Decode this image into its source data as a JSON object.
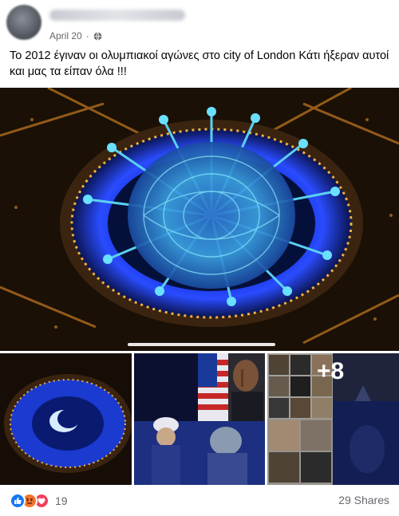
{
  "post": {
    "date": "April 20",
    "dot": "·",
    "text": "Το 2012 έγιναν οι ολυμπιακοί αγώνες στο city of London Κάτι ήξεραν αυτοί και μας τα είπαν όλα !!!",
    "privacy_icon": "globe-icon"
  },
  "media": {
    "more_count": "+8"
  },
  "footer": {
    "reaction_icons": [
      "like-icon",
      "angry-icon",
      "love-icon"
    ],
    "reaction_count": "19",
    "shares": "29 Shares"
  },
  "colors": {
    "text": "#050505",
    "secondary": "#65676b",
    "like": "#1877f2",
    "angry": "#f3742a",
    "love": "#f33e58"
  }
}
